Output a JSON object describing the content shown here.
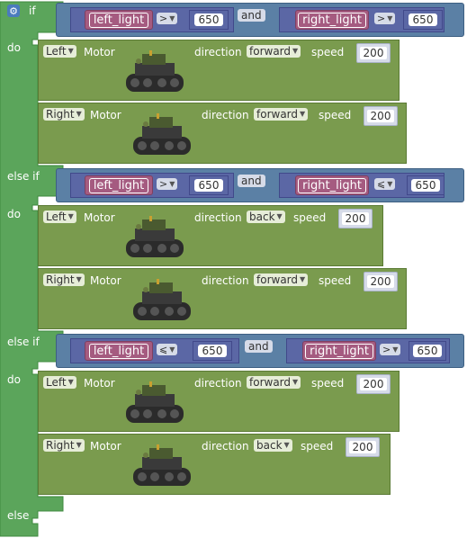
{
  "if_block": {
    "if_label": "if",
    "else_if_label": "else if",
    "do_label": "do",
    "else_label": "else"
  },
  "conditions": [
    {
      "left": {
        "var": "left_light",
        "op": ">",
        "value": "650"
      },
      "join": "and",
      "right": {
        "var": "right_light",
        "op": ">",
        "value": "650"
      }
    },
    {
      "left": {
        "var": "left_light",
        "op": ">",
        "value": "650"
      },
      "join": "and",
      "right": {
        "var": "right_light",
        "op": "⩽",
        "value": "650"
      }
    },
    {
      "left": {
        "var": "left_light",
        "op": "⩽",
        "value": "650"
      },
      "join": "and",
      "right": {
        "var": "right_light",
        "op": ">",
        "value": "650"
      }
    }
  ],
  "motor_blocks": [
    {
      "side": "Left",
      "label": "Motor",
      "direction_label": "direction",
      "direction": "forward",
      "speed_label": "speed",
      "speed": "200"
    },
    {
      "side": "Right",
      "label": "Motor",
      "direction_label": "direction",
      "direction": "forward",
      "speed_label": "speed",
      "speed": "200"
    },
    {
      "side": "Left",
      "label": "Motor",
      "direction_label": "direction",
      "direction": "back",
      "speed_label": "speed",
      "speed": "200"
    },
    {
      "side": "Right",
      "label": "Motor",
      "direction_label": "direction",
      "direction": "forward",
      "speed_label": "speed",
      "speed": "200"
    },
    {
      "side": "Left",
      "label": "Motor",
      "direction_label": "direction",
      "direction": "forward",
      "speed_label": "speed",
      "speed": "200"
    },
    {
      "side": "Right",
      "label": "Motor",
      "direction_label": "direction",
      "direction": "back",
      "speed_label": "speed",
      "speed": "200"
    }
  ],
  "icons": {
    "settings": "gear-icon",
    "robot": "robot-tank-image",
    "dropdown": "triangle-down-icon"
  },
  "colors": {
    "logic": "#5ba55b",
    "condition": "#5b80a5",
    "variable": "#a55b80",
    "math": "#5b67a5",
    "motor": "#7a9b4e"
  }
}
